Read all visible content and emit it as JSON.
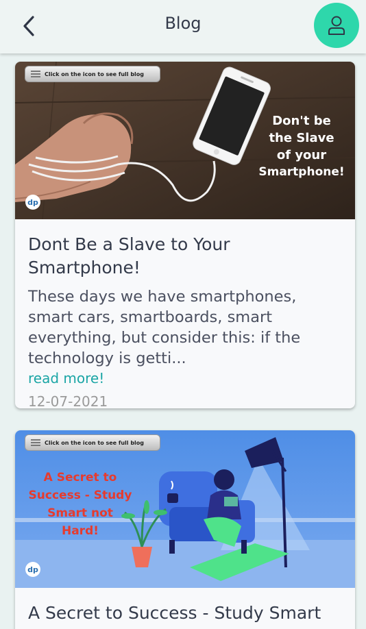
{
  "appbar": {
    "title": "Blog",
    "back_icon": "chevron-left-icon",
    "profile_icon": "user-icon",
    "accent": "#2ed7ab"
  },
  "posts": [
    {
      "image_pill": "Click on the icon to see full blog",
      "image_caption_lines": [
        "Don't be",
        "the Slave",
        "of your",
        "Smartphone!"
      ],
      "title": "Dont Be a Slave to Your Smartphone!",
      "excerpt": "These days we have smartphones, smart cars, smartboards, smart everything, but consider this: if the technology is getti...",
      "read_more": "read more!",
      "date": "12-07-2021"
    },
    {
      "image_pill": "Click on the icon to see full blog",
      "image_caption_lines": [
        "A Secret to",
        "Success - Study",
        "Smart not",
        "Hard!"
      ],
      "title": "A Secret to Success - Study Smart not Hard!"
    }
  ],
  "colors": {
    "link": "#1aa5a5",
    "date": "#9a9a9a",
    "title": "#333a4a",
    "caption_red": "#e63b2e"
  }
}
